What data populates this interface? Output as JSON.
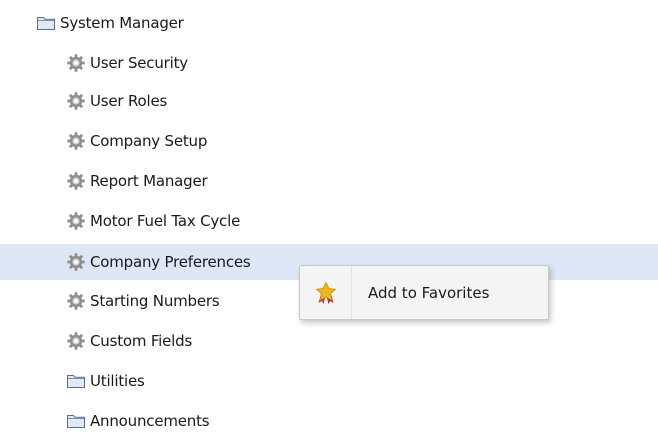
{
  "tree": {
    "root": {
      "label": "System Manager",
      "icon": "folder-icon"
    },
    "items": [
      {
        "label": "User Security",
        "icon": "gear-icon"
      },
      {
        "label": "User Roles",
        "icon": "gear-icon"
      },
      {
        "label": "Company Setup",
        "icon": "gear-icon"
      },
      {
        "label": "Report Manager",
        "icon": "gear-icon"
      },
      {
        "label": "Motor Fuel Tax Cycle",
        "icon": "gear-icon"
      },
      {
        "label": "Company Preferences",
        "icon": "gear-icon",
        "selected": true
      },
      {
        "label": "Starting Numbers",
        "icon": "gear-icon"
      },
      {
        "label": "Custom Fields",
        "icon": "gear-icon"
      },
      {
        "label": "Utilities",
        "icon": "folder-icon"
      },
      {
        "label": "Announcements",
        "icon": "folder-icon"
      }
    ]
  },
  "context_menu": {
    "items": [
      {
        "label": "Add to Favorites",
        "icon": "star-ribbon-icon"
      }
    ]
  },
  "colors": {
    "selected_row": "#dde7f5",
    "folder_fill": "#dfe9f5",
    "folder_stroke": "#5a6f8c",
    "gear": "#8e8e8e",
    "star": "#f2b51c",
    "ribbon": "#d9342b"
  }
}
